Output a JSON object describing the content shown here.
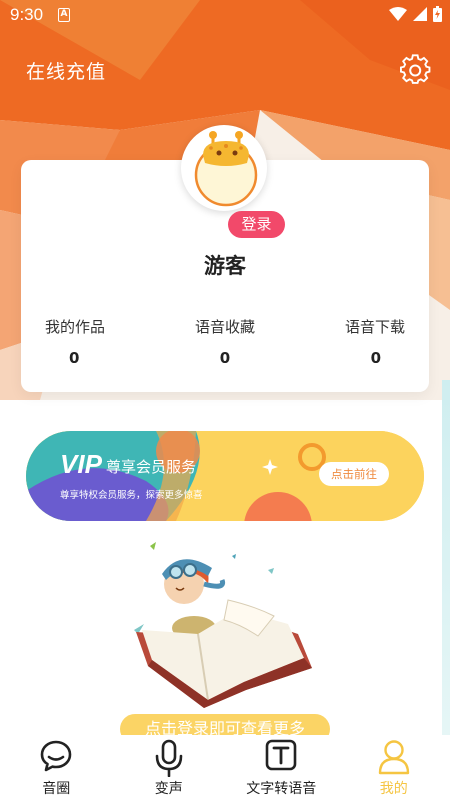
{
  "status_bar": {
    "time": "9:30",
    "a_icon": "A"
  },
  "header": {
    "title": "在线充值"
  },
  "profile": {
    "login_label": "登录",
    "username": "游客",
    "stats": [
      {
        "label": "我的作品",
        "value": "0"
      },
      {
        "label": "语音收藏",
        "value": "0"
      },
      {
        "label": "语音下载",
        "value": "0"
      }
    ]
  },
  "vip": {
    "logo": "VIP",
    "title": "尊享会员服务",
    "subtitle": "尊享特权会员服务，探索更多惊喜",
    "button": "点击前往"
  },
  "view_more_label": "点击登录即可查看更多",
  "tabbar": {
    "items": [
      {
        "label": "音圈",
        "icon": "chat-bubble-icon"
      },
      {
        "label": "变声",
        "icon": "microphone-icon"
      },
      {
        "label": "文字转语音",
        "icon": "text-icon"
      },
      {
        "label": "我的",
        "icon": "person-icon"
      }
    ],
    "active": 3
  },
  "colors": {
    "accent": "#f5c542",
    "login_badge": "#f2496a",
    "header_orange": "#ef6b27"
  }
}
